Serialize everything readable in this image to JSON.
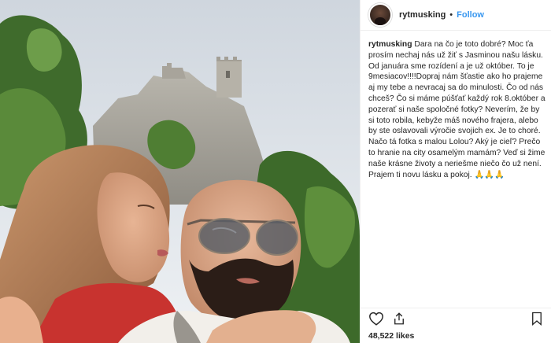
{
  "post": {
    "username": "rytmusking",
    "separator": "•",
    "follow_label": "Follow",
    "caption_username": "rytmusking",
    "caption_text": "Dara na čo je toto dobré? Moc ťa prosím nechaj nás už žiť s Jasminou našu lásku. Od januára sme rozídení a je už október. To je 9mesiacov!!!!Dopraj nám šťastie ako ho prajeme aj my tebe a nevracaj sa do minulosti. Čo od nás chceš? Čo si máme púšťať každý rok 8.október a pozerať si naše spoločné fotky? Neverím, že by si toto robila, keby​že máš nového frajera, alebo by ste oslavovali výročie svojich ex. Je to choré. Načo tá fotka s malou Lolou? Aký je cieľ? Prečo to hranie na city osamelým mamám? Veď si žime naše krásne životy a neriešme niečo čo už není. Prajem ti novu lásku a pokoj. 🙏🙏🙏",
    "likes": "48,522 likes"
  },
  "icons": {
    "avatar": "profile-avatar",
    "like": "heart-icon",
    "share": "share-icon",
    "save": "bookmark-icon"
  },
  "colors": {
    "follow": "#3897f0",
    "text": "#262626",
    "divider": "#efefef"
  }
}
